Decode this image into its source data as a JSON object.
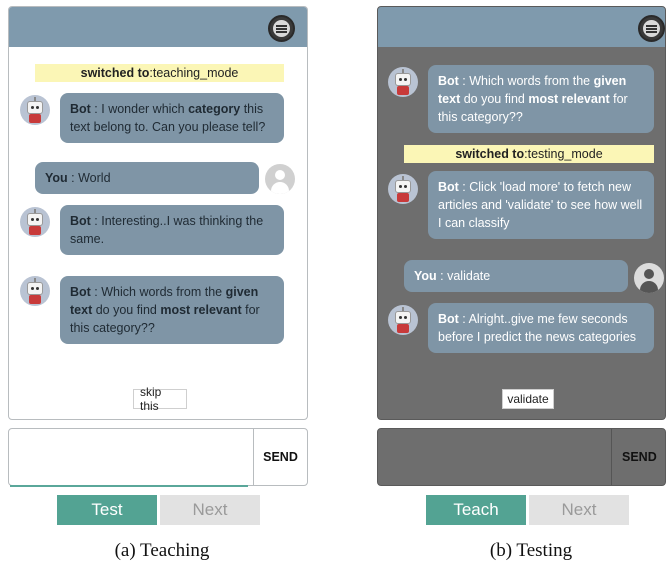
{
  "panel_a": {
    "notice_prefix": "switched to",
    "notice_sep": " : ",
    "notice_value": "teaching_mode",
    "messages": [
      {
        "speaker": "Bot",
        "sep": " : ",
        "t1": "I wonder which ",
        "b1": "category",
        "t2": " this text belong to. Can you please tell?"
      },
      {
        "speaker": "You",
        "sep": " : ",
        "t1": "World"
      },
      {
        "speaker": "Bot",
        "sep": " : ",
        "t1": "Interesting..I was thinking the same."
      },
      {
        "speaker": "Bot",
        "sep": " : ",
        "t1": "Which words from the ",
        "b1": "given text",
        "t2": " do you find ",
        "b2": "most relevant",
        "t3": " for this category??"
      }
    ],
    "action_label": "skip this",
    "input_placeholder": "",
    "send_label": "SEND",
    "primary_label": "Test",
    "secondary_label": "Next",
    "caption": "(a) Teaching"
  },
  "panel_b": {
    "messages": [
      {
        "speaker": "Bot",
        "sep": " : ",
        "t1": "Which words from the ",
        "b1": "given text",
        "t2": " do you find ",
        "b2": "most relevant",
        "t3": " for this category??"
      },
      {
        "speaker": "Bot",
        "sep": " : ",
        "t1": "Click 'load more' to fetch new articles and 'validate' to see how well I can classify"
      },
      {
        "speaker": "You",
        "sep": " : ",
        "t1": "validate"
      },
      {
        "speaker": "Bot",
        "sep": " : ",
        "t1": "Alright..give me few seconds before I predict the news categories"
      }
    ],
    "notice_prefix": "switched to",
    "notice_sep": " : ",
    "notice_value": "testing_mode",
    "action_label": "validate",
    "input_placeholder": "",
    "send_label": "SEND",
    "primary_label": "Teach",
    "secondary_label": "Next",
    "caption": "(b) Testing"
  },
  "icons": {
    "settings": "sliders-icon",
    "bot": "robot-avatar-icon",
    "user": "user-avatar-icon"
  },
  "colors": {
    "header": "#7f9aad",
    "bubble": "#7f95a6",
    "notice": "#fbf6b6",
    "primary_button": "#53a393",
    "dark_panel": "#6e6e6e"
  }
}
